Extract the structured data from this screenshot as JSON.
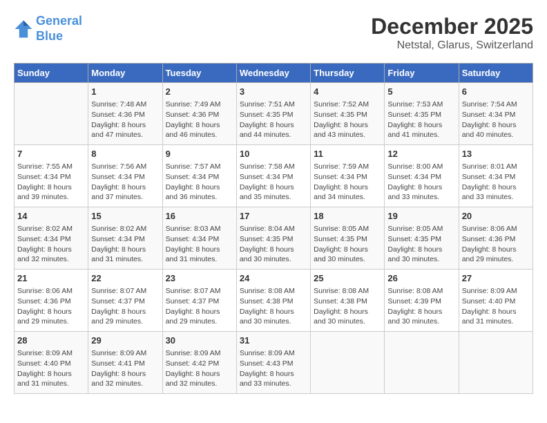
{
  "header": {
    "logo_line1": "General",
    "logo_line2": "Blue",
    "title": "December 2025",
    "subtitle": "Netstal, Glarus, Switzerland"
  },
  "columns": [
    "Sunday",
    "Monday",
    "Tuesday",
    "Wednesday",
    "Thursday",
    "Friday",
    "Saturday"
  ],
  "weeks": [
    [
      {
        "day": "",
        "info": ""
      },
      {
        "day": "1",
        "info": "Sunrise: 7:48 AM\nSunset: 4:36 PM\nDaylight: 8 hours\nand 47 minutes."
      },
      {
        "day": "2",
        "info": "Sunrise: 7:49 AM\nSunset: 4:36 PM\nDaylight: 8 hours\nand 46 minutes."
      },
      {
        "day": "3",
        "info": "Sunrise: 7:51 AM\nSunset: 4:35 PM\nDaylight: 8 hours\nand 44 minutes."
      },
      {
        "day": "4",
        "info": "Sunrise: 7:52 AM\nSunset: 4:35 PM\nDaylight: 8 hours\nand 43 minutes."
      },
      {
        "day": "5",
        "info": "Sunrise: 7:53 AM\nSunset: 4:35 PM\nDaylight: 8 hours\nand 41 minutes."
      },
      {
        "day": "6",
        "info": "Sunrise: 7:54 AM\nSunset: 4:34 PM\nDaylight: 8 hours\nand 40 minutes."
      }
    ],
    [
      {
        "day": "7",
        "info": "Sunrise: 7:55 AM\nSunset: 4:34 PM\nDaylight: 8 hours\nand 39 minutes."
      },
      {
        "day": "8",
        "info": "Sunrise: 7:56 AM\nSunset: 4:34 PM\nDaylight: 8 hours\nand 37 minutes."
      },
      {
        "day": "9",
        "info": "Sunrise: 7:57 AM\nSunset: 4:34 PM\nDaylight: 8 hours\nand 36 minutes."
      },
      {
        "day": "10",
        "info": "Sunrise: 7:58 AM\nSunset: 4:34 PM\nDaylight: 8 hours\nand 35 minutes."
      },
      {
        "day": "11",
        "info": "Sunrise: 7:59 AM\nSunset: 4:34 PM\nDaylight: 8 hours\nand 34 minutes."
      },
      {
        "day": "12",
        "info": "Sunrise: 8:00 AM\nSunset: 4:34 PM\nDaylight: 8 hours\nand 33 minutes."
      },
      {
        "day": "13",
        "info": "Sunrise: 8:01 AM\nSunset: 4:34 PM\nDaylight: 8 hours\nand 33 minutes."
      }
    ],
    [
      {
        "day": "14",
        "info": "Sunrise: 8:02 AM\nSunset: 4:34 PM\nDaylight: 8 hours\nand 32 minutes."
      },
      {
        "day": "15",
        "info": "Sunrise: 8:02 AM\nSunset: 4:34 PM\nDaylight: 8 hours\nand 31 minutes."
      },
      {
        "day": "16",
        "info": "Sunrise: 8:03 AM\nSunset: 4:34 PM\nDaylight: 8 hours\nand 31 minutes."
      },
      {
        "day": "17",
        "info": "Sunrise: 8:04 AM\nSunset: 4:35 PM\nDaylight: 8 hours\nand 30 minutes."
      },
      {
        "day": "18",
        "info": "Sunrise: 8:05 AM\nSunset: 4:35 PM\nDaylight: 8 hours\nand 30 minutes."
      },
      {
        "day": "19",
        "info": "Sunrise: 8:05 AM\nSunset: 4:35 PM\nDaylight: 8 hours\nand 30 minutes."
      },
      {
        "day": "20",
        "info": "Sunrise: 8:06 AM\nSunset: 4:36 PM\nDaylight: 8 hours\nand 29 minutes."
      }
    ],
    [
      {
        "day": "21",
        "info": "Sunrise: 8:06 AM\nSunset: 4:36 PM\nDaylight: 8 hours\nand 29 minutes."
      },
      {
        "day": "22",
        "info": "Sunrise: 8:07 AM\nSunset: 4:37 PM\nDaylight: 8 hours\nand 29 minutes."
      },
      {
        "day": "23",
        "info": "Sunrise: 8:07 AM\nSunset: 4:37 PM\nDaylight: 8 hours\nand 29 minutes."
      },
      {
        "day": "24",
        "info": "Sunrise: 8:08 AM\nSunset: 4:38 PM\nDaylight: 8 hours\nand 30 minutes."
      },
      {
        "day": "25",
        "info": "Sunrise: 8:08 AM\nSunset: 4:38 PM\nDaylight: 8 hours\nand 30 minutes."
      },
      {
        "day": "26",
        "info": "Sunrise: 8:08 AM\nSunset: 4:39 PM\nDaylight: 8 hours\nand 30 minutes."
      },
      {
        "day": "27",
        "info": "Sunrise: 8:09 AM\nSunset: 4:40 PM\nDaylight: 8 hours\nand 31 minutes."
      }
    ],
    [
      {
        "day": "28",
        "info": "Sunrise: 8:09 AM\nSunset: 4:40 PM\nDaylight: 8 hours\nand 31 minutes."
      },
      {
        "day": "29",
        "info": "Sunrise: 8:09 AM\nSunset: 4:41 PM\nDaylight: 8 hours\nand 32 minutes."
      },
      {
        "day": "30",
        "info": "Sunrise: 8:09 AM\nSunset: 4:42 PM\nDaylight: 8 hours\nand 32 minutes."
      },
      {
        "day": "31",
        "info": "Sunrise: 8:09 AM\nSunset: 4:43 PM\nDaylight: 8 hours\nand 33 minutes."
      },
      {
        "day": "",
        "info": ""
      },
      {
        "day": "",
        "info": ""
      },
      {
        "day": "",
        "info": ""
      }
    ]
  ]
}
